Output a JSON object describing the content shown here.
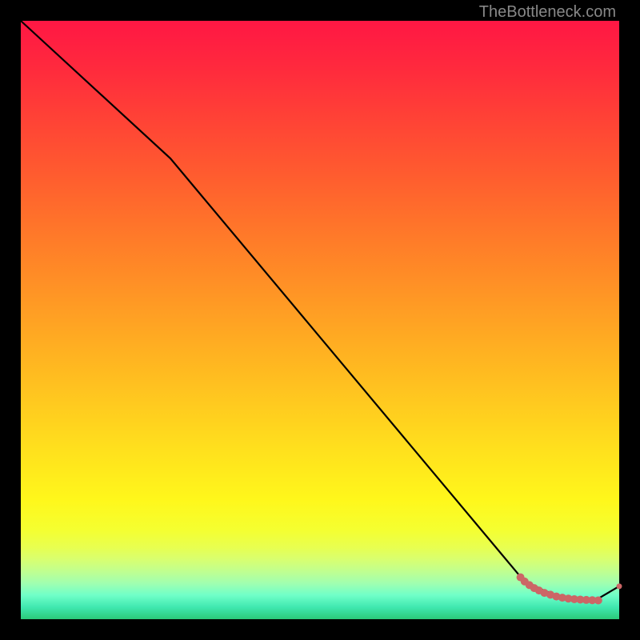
{
  "watermark": "TheBottleneck.com",
  "chart_data": {
    "type": "line",
    "title": "",
    "xlabel": "",
    "ylabel": "",
    "xlim": [
      0,
      100
    ],
    "ylim": [
      0,
      100
    ],
    "series": [
      {
        "name": "curve",
        "x": [
          0,
          25,
          84,
          85,
          86,
          87,
          88,
          89,
          90,
          91,
          92,
          93,
          94,
          95,
          96,
          100
        ],
        "y": [
          100,
          77,
          6.5,
          6.0,
          5.5,
          5.0,
          4.6,
          4.2,
          3.9,
          3.6,
          3.4,
          3.3,
          3.2,
          3.2,
          3.15,
          5.5
        ]
      }
    ],
    "markers": [
      {
        "x": 83.5,
        "y": 7.0
      },
      {
        "x": 84.2,
        "y": 6.3
      },
      {
        "x": 85.0,
        "y": 5.7
      },
      {
        "x": 85.8,
        "y": 5.2
      },
      {
        "x": 86.6,
        "y": 4.8
      },
      {
        "x": 87.5,
        "y": 4.4
      },
      {
        "x": 88.5,
        "y": 4.1
      },
      {
        "x": 89.5,
        "y": 3.8
      },
      {
        "x": 90.5,
        "y": 3.6
      },
      {
        "x": 91.5,
        "y": 3.45
      },
      {
        "x": 92.5,
        "y": 3.35
      },
      {
        "x": 93.5,
        "y": 3.28
      },
      {
        "x": 94.5,
        "y": 3.22
      },
      {
        "x": 95.5,
        "y": 3.18
      },
      {
        "x": 96.5,
        "y": 3.15
      },
      {
        "x": 100,
        "y": 5.5
      }
    ],
    "colors": {
      "line": "#000000",
      "marker": "#cc6666"
    }
  }
}
